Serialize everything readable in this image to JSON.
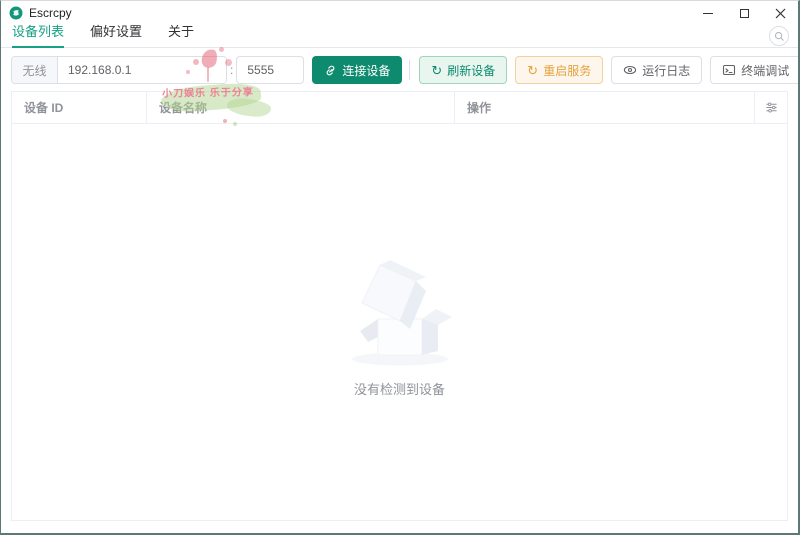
{
  "window": {
    "title": "Escrcpy"
  },
  "tabs": {
    "items": [
      {
        "label": "设备列表",
        "active": true
      },
      {
        "label": "偏好设置",
        "active": false
      },
      {
        "label": "关于",
        "active": false
      }
    ]
  },
  "toolbar": {
    "mode_label": "无线",
    "ip_value": "192.168.0.1",
    "separator": ":",
    "port_value": "5555",
    "connect_label": "连接设备",
    "refresh_label": "刷新设备",
    "restart_label": "重启服务",
    "logs_label": "运行日志",
    "terminal_label": "终端调试"
  },
  "table": {
    "columns": [
      {
        "label": "设备 ID"
      },
      {
        "label": "设备名称"
      },
      {
        "label": "操作"
      }
    ],
    "empty_text": "没有检测到设备"
  },
  "watermark": {
    "text": "小刀娱乐 乐于分享"
  },
  "icons": {
    "app_logo": "escrcpy-round-logo",
    "minimize": "minus-bar",
    "maximize": "square-outline",
    "close": "✕",
    "search": "magnifier",
    "connect": "link",
    "refresh": "↻",
    "restart": "↻",
    "logs": "eye",
    "terminal": "monitor",
    "column_settings": "sliders"
  },
  "colors": {
    "theme_green": "#0e8a6e",
    "tab_active": "#16a184",
    "warning": "#e6a23c",
    "border": "#dcdfe6",
    "table_border": "#ebeef5",
    "muted_text": "#909399",
    "window_frame": "#5e7975"
  }
}
